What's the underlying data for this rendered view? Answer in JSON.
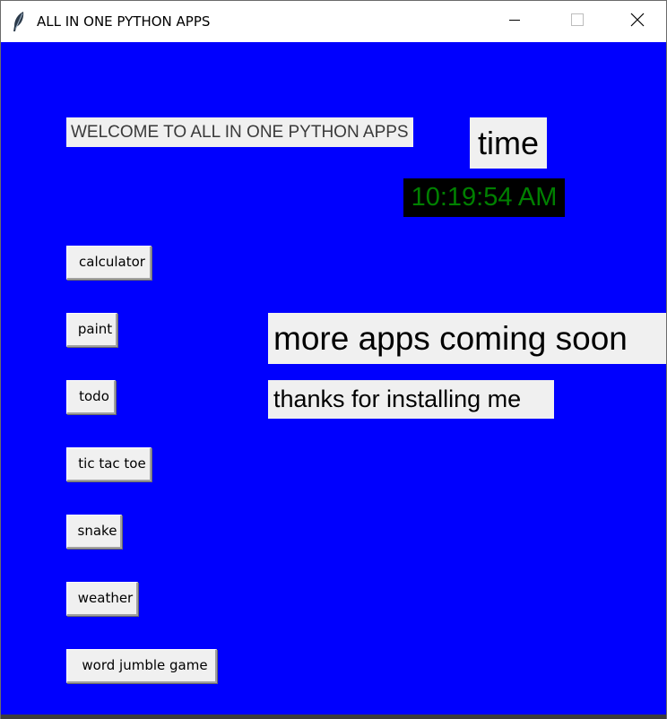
{
  "window": {
    "title": "ALL IN ONE PYTHON APPS",
    "app_icon": "feather-icon",
    "controls": {
      "minimize_icon": "minimize-icon",
      "maximize_icon": "maximize-icon",
      "close_icon": "close-icon"
    }
  },
  "colors": {
    "background": "#0000fe",
    "label_bg": "#f0f0f0",
    "clock_bg": "#000000",
    "clock_fg": "#008000"
  },
  "main": {
    "welcome": "WELCOME TO ALL IN ONE PYTHON APPS",
    "time_label": "time",
    "clock": "10:19:54 AM",
    "coming_soon": "more apps coming soon",
    "thanks": "thanks for installing me"
  },
  "apps": [
    {
      "label": "calculator"
    },
    {
      "label": "paint"
    },
    {
      "label": "todo"
    },
    {
      "label": "tic tac toe"
    },
    {
      "label": "snake"
    },
    {
      "label": "weather"
    },
    {
      "label": "word jumble game"
    }
  ]
}
